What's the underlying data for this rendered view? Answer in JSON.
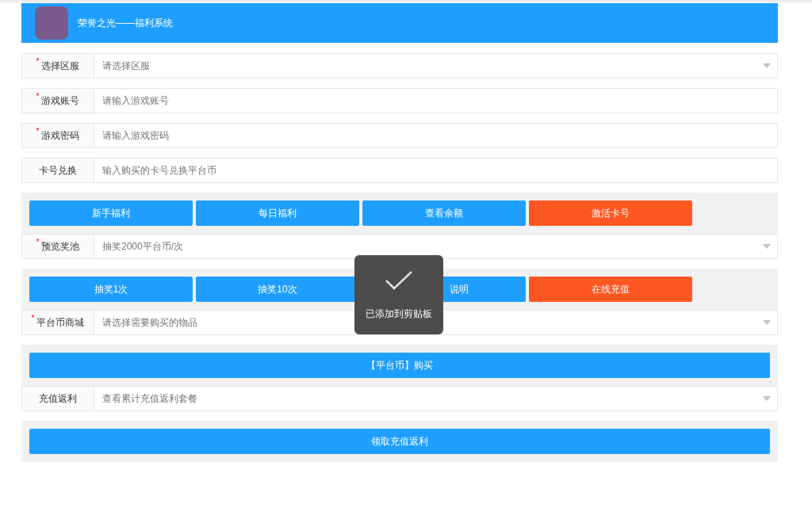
{
  "header": {
    "title": "荣誉之光——福利系统"
  },
  "sections": [
    {
      "kind": "select",
      "marker": "*",
      "label": "选择区服",
      "placeholder": "请选择区服"
    },
    {
      "kind": "input",
      "marker": "*",
      "label": "游戏账号",
      "placeholder": "请输入游戏账号"
    },
    {
      "kind": "input",
      "marker": "*",
      "label": "游戏密码",
      "placeholder": "请输入游戏密码"
    },
    {
      "kind": "input",
      "label": "卡号兑换",
      "placeholder": "输入购买的卡号兑换平台币"
    },
    {
      "kind": "buttons",
      "buttons": [
        {
          "label": "新手福利",
          "color": "#1e9fff"
        },
        {
          "label": "每日福利",
          "color": "#1e9fff"
        },
        {
          "label": "查看余额",
          "color": "#1e9fff"
        },
        {
          "label": "激活卡号",
          "color": "#ff5722"
        }
      ]
    },
    {
      "kind": "select",
      "marker": "*",
      "label": "预览奖池",
      "value": "抽奖2000平台币/次"
    },
    {
      "kind": "buttons",
      "buttons": [
        {
          "label": "抽奖1次",
          "color": "#1e9fff"
        },
        {
          "label": "抽奖10次",
          "color": "#1e9fff"
        },
        {
          "label": "说明",
          "color": "#1e9fff",
          "covered": true
        },
        {
          "label": "在线充值",
          "color": "#ff5722"
        }
      ]
    },
    {
      "kind": "select",
      "marker": "*",
      "label": "平台币商城",
      "placeholder": "请选择需要购买的物品"
    },
    {
      "kind": "buttons",
      "buttons": [
        {
          "label": "【平台币】购买",
          "color": "#1e9fff"
        }
      ]
    },
    {
      "kind": "select",
      "label": "充值返利",
      "placeholder": "查看累计充值返利套餐"
    },
    {
      "kind": "buttons",
      "buttons": [
        {
          "label": "领取充值返利",
          "color": "#1e9fff"
        }
      ]
    }
  ],
  "toast": {
    "message": "已添加到剪贴板"
  }
}
